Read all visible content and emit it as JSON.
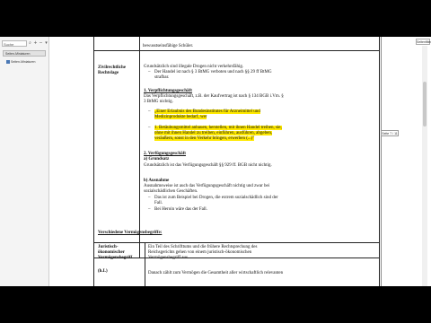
{
  "sidebar": {
    "search_placeholder": "Suche",
    "tab_label": "Seiten-Miniaturen",
    "item_label": "Seiten-Miniaturen"
  },
  "toolbar": {
    "right_badge": "Seitenfilter",
    "page_indicator": "Seite 7 / 11"
  },
  "document": {
    "top_line": "bewusstseinsfähige Schüler.",
    "section1": {
      "left_title_lines": [
        "Zivilrechtliche",
        "Rechtslage"
      ],
      "intro": "Grundsätzlich sind illegale Drogen nicht verkehrsfähig.",
      "intro_bullet_lines": [
        "Der Handel ist nach § 3 BtMG verboten und nach §§ 29 ff BtMG",
        "strafbar."
      ],
      "heading1": "1. Verpflichtungsgeschäft",
      "para1_lines": [
        "Das Verpflichtungsgeschäft, z.B. der Kaufvertrag ist nach § 134 BGB i.Vm. §",
        "3 BtMG nichtig."
      ],
      "quote1_lines": [
        "„Einer Erlaubnis des Bundesinstitutes für Arzneimittel und",
        "Medizinprodukte bedarf, wer"
      ],
      "quote2_lines": [
        "1. Betäubungsmittel anbauen, herstellen, mit ihnen Handel treiben, sie,",
        "ohne mit ihnen Handel zu treiben, einführen, ausführen, abgeben,",
        "veräußern, sonst in den Verkehr bringen, erwerben (...)\""
      ],
      "heading2": "2. Verfügungsgeschäft",
      "sub_a": "a) Grundsatz",
      "para2": "Grundsätzlich ist das Verfügungsgeschäft §§ 929 ff. BGB nicht nichtig.",
      "sub_b": "b) Ausnahme",
      "para3_lines": [
        "Ausnahmsweise ist auch das Verfügungsgeschäft nichtig und zwar bei",
        "sozialschädlichen Geschäften."
      ],
      "exception_bullets": [
        [
          "Das ist zum Beispiel bei Drogen, die extrem sozialschädlich sind der",
          "Fall."
        ],
        [
          "Bei Heroin wäre das der Fall."
        ]
      ]
    },
    "section2_heading": "Verschiedene Vermögensbegriffe:",
    "section2": {
      "left_lines": [
        "Juristisch-",
        "ökonomischer",
        "Vermögensbegriff"
      ],
      "left_note": "(h.L)",
      "right_lines": [
        "Ein Teil des Schrifttums und die frühere Rechtsprechung des",
        "Reichsgerichts gehen von einem juristisch-ökonomischen",
        "Vermögensbegriff aus."
      ],
      "right_line2": "Danach zählt zum Vermögen die Gesamtheit aller wirtschaftlich relevanten"
    }
  },
  "colors": {
    "highlight": "#ffe900",
    "border": "#222222",
    "bookmark_icon": "#4a78b5"
  }
}
